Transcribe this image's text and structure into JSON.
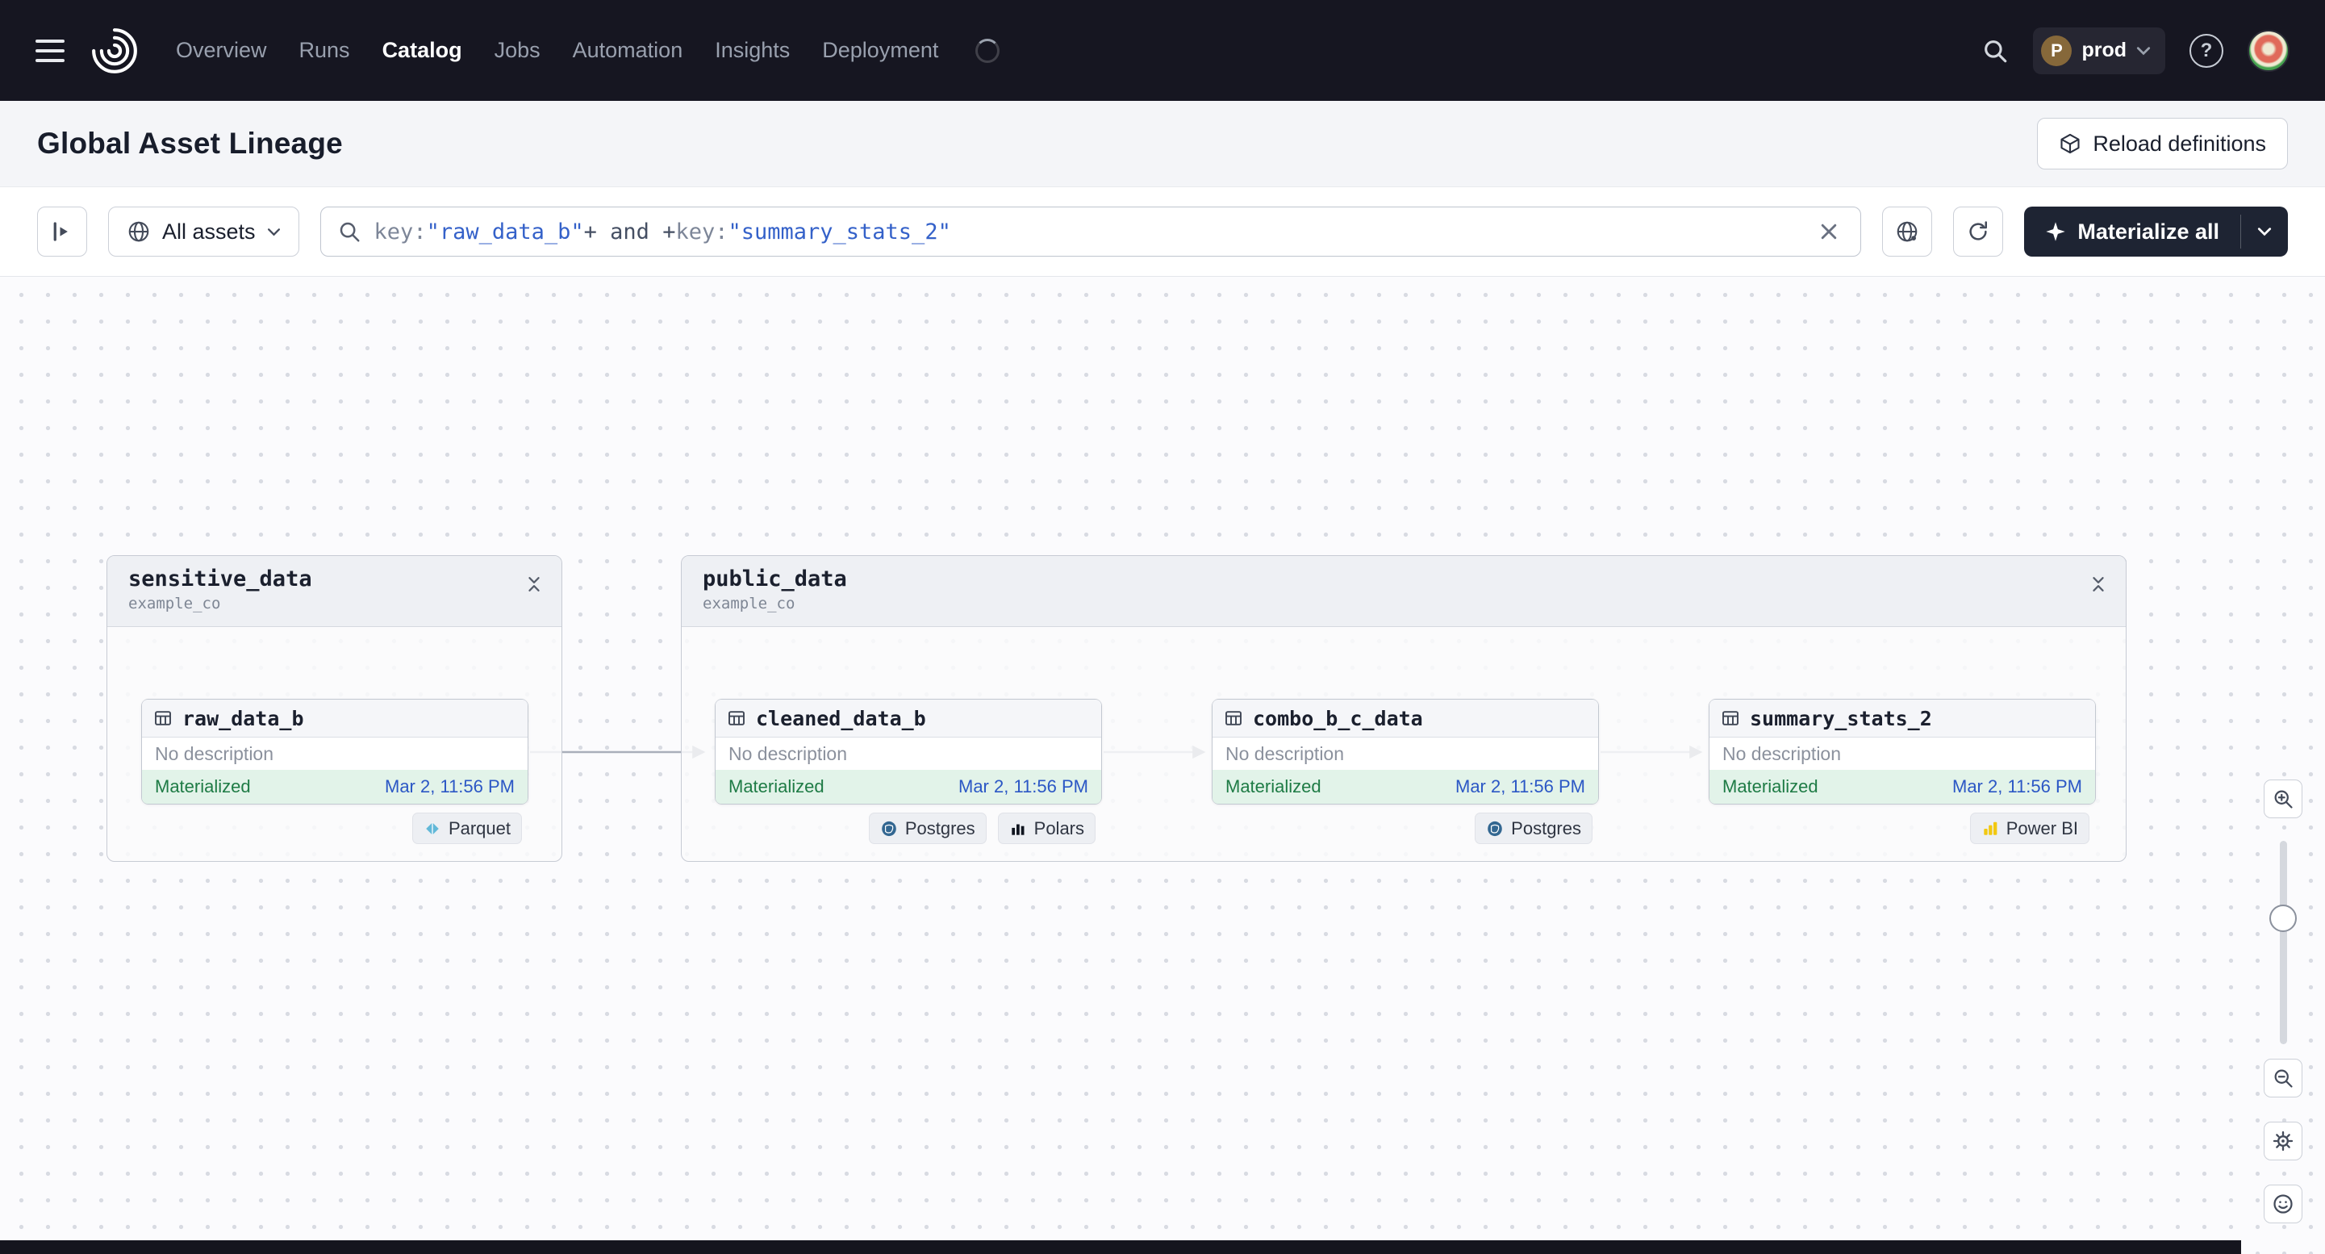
{
  "navbar": {
    "nav_items": [
      {
        "label": "Overview"
      },
      {
        "label": "Runs"
      },
      {
        "label": "Catalog"
      },
      {
        "label": "Jobs"
      },
      {
        "label": "Automation"
      },
      {
        "label": "Insights"
      },
      {
        "label": "Deployment"
      }
    ],
    "active_item": "Catalog",
    "deployment_switcher": {
      "initial": "P",
      "label": "prod"
    },
    "help_label": "?"
  },
  "header": {
    "title": "Global Asset Lineage",
    "reload_button_label": "Reload definitions"
  },
  "toolbar": {
    "scope_button_label": "All assets",
    "search": {
      "tokens": [
        {
          "text": "key:",
          "kind": "attribute"
        },
        {
          "text": "\"raw_data_b\"",
          "kind": "value"
        },
        {
          "text": "+ and +",
          "kind": "operator"
        },
        {
          "text": "key:",
          "kind": "attribute"
        },
        {
          "text": "\"summary_stats_2\"",
          "kind": "value"
        }
      ]
    },
    "materialize_button_label": "Materialize all"
  },
  "graph": {
    "groups": [
      {
        "name": "sensitive_data",
        "location": "example_co",
        "nodes": [
          {
            "name": "raw_data_b",
            "description": "No description",
            "status": "Materialized",
            "timestamp": "Mar 2, 11:56 PM",
            "tags": [
              {
                "label": "Parquet",
                "icon": "parquet-icon"
              }
            ]
          }
        ]
      },
      {
        "name": "public_data",
        "location": "example_co",
        "nodes": [
          {
            "name": "cleaned_data_b",
            "description": "No description",
            "status": "Materialized",
            "timestamp": "Mar 2, 11:56 PM",
            "tags": [
              {
                "label": "Postgres",
                "icon": "postgres-icon"
              },
              {
                "label": "Polars",
                "icon": "polars-icon"
              }
            ]
          },
          {
            "name": "combo_b_c_data",
            "description": "No description",
            "status": "Materialized",
            "timestamp": "Mar 2, 11:56 PM",
            "tags": [
              {
                "label": "Postgres",
                "icon": "postgres-icon"
              }
            ]
          },
          {
            "name": "summary_stats_2",
            "description": "No description",
            "status": "Materialized",
            "timestamp": "Mar 2, 11:56 PM",
            "tags": [
              {
                "label": "Power BI",
                "icon": "powerbi-icon"
              }
            ]
          }
        ]
      }
    ],
    "edges": [
      {
        "from": "raw_data_b",
        "to": "cleaned_data_b"
      },
      {
        "from": "cleaned_data_b",
        "to": "combo_b_c_data"
      },
      {
        "from": "combo_b_c_data",
        "to": "summary_stats_2"
      }
    ]
  },
  "colors": {
    "navbar_bg": "#161621",
    "dark_button_bg": "#1e2433",
    "materialized_bg": "#e2f3e9",
    "materialized_text": "#1e7b45",
    "timestamp_link_blue": "#2b57c5",
    "query_value_blue": "#3461c9",
    "query_attr_gray": "#7d8698",
    "parquet_teal": "#62b8d8",
    "postgres_blue": "#336791",
    "powerbi_yellow": "#f2c811",
    "deployment_badge_brown": "#86683a"
  }
}
